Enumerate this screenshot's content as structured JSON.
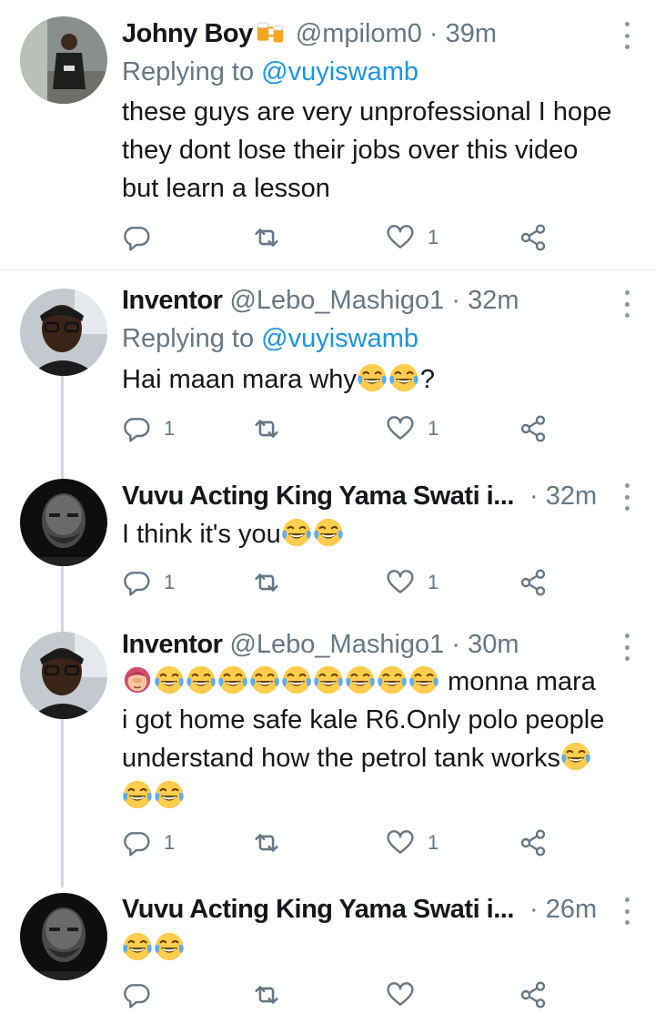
{
  "tweets": [
    {
      "name": "Johny Boy",
      "handle": "@mpilom0",
      "time": "39m",
      "replying_label": "Replying to",
      "replying_to": "@vuyiswamb",
      "lines": [
        "these guys are very unprofessional  I hope",
        "they dont lose their jobs over this video",
        "but learn a lesson"
      ],
      "replies": "",
      "likes": "1"
    },
    {
      "name": "Inventor",
      "handle": "@Lebo_Mashigo1",
      "time": "32m",
      "replying_label": "Replying to",
      "replying_to": "@vuyiswamb",
      "text_before": "Hai maan mara why",
      "text_after": "?",
      "replies": "1",
      "likes": "1"
    },
    {
      "name": "Vuvu Acting King Yama Swati i...",
      "time": "32m",
      "text_before": "I think it's you",
      "replies": "1",
      "likes": "1"
    },
    {
      "name": "Inventor",
      "handle": "@Lebo_Mashigo1",
      "time": "30m",
      "line1_text": "monna mara",
      "line2": "i got home safe kale R6.Only polo people",
      "line3": "understand how the petrol tank works",
      "replies": "1",
      "likes": "1"
    },
    {
      "name": "Vuvu Acting King Yama Swati i...",
      "time": "26m",
      "replies": "",
      "likes": ""
    }
  ],
  "separator": "·",
  "icons": {
    "reply": "reply-icon",
    "retweet": "retweet-icon",
    "like": "heart-icon",
    "share": "share-icon",
    "more": "more-vertical-icon",
    "emoji": "tears-of-joy-emoji",
    "facepalm": "woman-facepalming-emoji",
    "beer": "beer-mugs-emoji"
  },
  "colors": {
    "link": "#1b95e0",
    "secondary": "#657786",
    "text": "#14171a",
    "thread_line": "#cfd9de"
  }
}
